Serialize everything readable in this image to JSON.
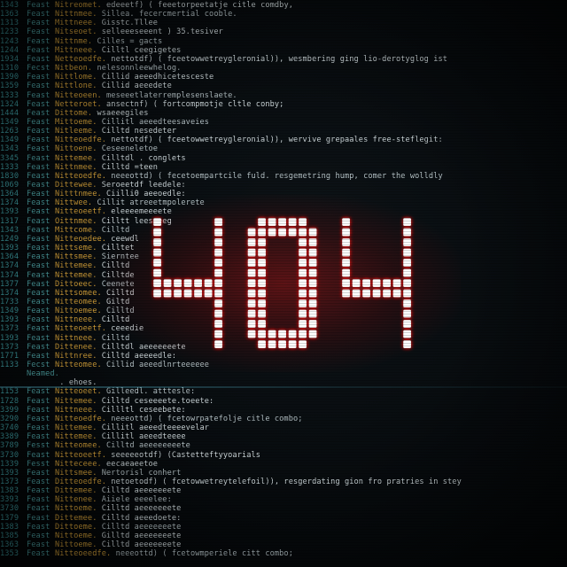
{
  "error": {
    "code": "404",
    "glow_color": "#c81818",
    "dot_color": "#ffffff"
  },
  "colors": {
    "line_number": "#3f9fa4",
    "keyword": "#4fa6a8",
    "class_name": "#d9a43a",
    "code_text": "#cfd9dc",
    "background": "#050a0d"
  },
  "code_lines": [
    {
      "num": "1343",
      "kw": "Feast",
      "cls": "Nitreomet.",
      "rest": "edeeetf) ( feeetorpeetatje citle comdby,"
    },
    {
      "num": "1363",
      "kw": "Feast",
      "cls": "Nittnmee.",
      "rest": "Sillea.  fecercmertial cooble."
    },
    {
      "num": "1313",
      "kw": "Feast",
      "cls": "Mittneee.",
      "rest": "Gisstc.Tllee"
    },
    {
      "num": "1233",
      "kw": "Feast",
      "cls": "Nitseoet.",
      "rest": "selleeeseeent ) 35.tesiver"
    },
    {
      "num": "1243",
      "kw": "Feast",
      "cls": "Nittnme.",
      "rest": "Cilles  =  gacts"
    },
    {
      "num": "1244",
      "kw": "Feast",
      "cls": "Mittneee.",
      "rest": "Cilltl ceegigetes"
    },
    {
      "num": "1934",
      "kw": "Feast",
      "cls": "Netteoedfe.",
      "rest": "nettotdf) ( fceetowwetreygleronial)), wesmbering ging lio-derotyglog ist"
    },
    {
      "num": "1310",
      "kw": "Fecst",
      "cls": "Nitbeon.",
      "rest": "nelesonnleewhelog."
    },
    {
      "num": "1390",
      "kw": "Feast",
      "cls": "Nittlome.",
      "rest": "Cillid  aeeedhicetesceste"
    },
    {
      "num": "1359",
      "kw": "Feast",
      "cls": "Nittlone.",
      "rest": "Cillid  aeeedete"
    },
    {
      "num": "1333",
      "kw": "Feast",
      "cls": "Nitteoeen.",
      "rest": "meseeetlaterremplesenslaete."
    },
    {
      "num": "1324",
      "kw": "Feast",
      "cls": "Netteroet.",
      "rest": "ansectnf) ( fortcompmotje cltle conby;"
    },
    {
      "num": "1444",
      "kw": "Feast",
      "cls": "Dittome.",
      "rest": "wsaeeegiles"
    },
    {
      "num": "1349",
      "kw": "Feast",
      "cls": "Mittoeme.",
      "rest": "Cillitl aeeedteesaveies"
    },
    {
      "num": "1263",
      "kw": "Feast",
      "cls": "Nitleeme.",
      "rest": "Cilltd  nesedeter"
    },
    {
      "num": "1349",
      "kw": "Feast",
      "cls": "Nitteoedfe.",
      "rest": "nettotdf) ( fceetowwetreygleronial)), wervive grepaales free-steflegit:"
    },
    {
      "num": "1343",
      "kw": "Feast",
      "cls": "Nittoene.",
      "rest": "Ceseeneletoe"
    },
    {
      "num": "3345",
      "kw": "Feast",
      "cls": "Nittemee.",
      "rest": "Cilltdl . conglets"
    },
    {
      "num": "1333",
      "kw": "Feast",
      "cls": "Nittnmee.",
      "rest": "Cilltd  =teen"
    },
    {
      "num": "1830",
      "kw": "Feast",
      "cls": "Nitteoedfe.",
      "rest": "neeeottd) ( fecetoempartcile fuld. resgemetring hump, comer the wolldly"
    },
    {
      "num": "1069",
      "kw": "Feast",
      "cls": "Dittewee.",
      "rest": "Seroeetdf  leedele:"
    },
    {
      "num": "1364",
      "kw": "Feast",
      "cls": "Nitttnmee.",
      "rest": "Ciilli0  aeeoedle:"
    },
    {
      "num": "1374",
      "kw": "Feast",
      "cls": "Nittwee.",
      "rest": "Cillit  atreeetmpolerete"
    },
    {
      "num": "1393",
      "kw": "Feast",
      "cls": "Nitteoeetf.",
      "rest": "eleeeemeeeete"
    },
    {
      "num": "1317",
      "kw": "Feast",
      "cls": "Oittnmee.",
      "rest": "Cilltt  leeseeeg"
    },
    {
      "num": "1343",
      "kw": "Feast",
      "cls": "Mittcome.",
      "rest": "Cilltd"
    },
    {
      "num": "1249",
      "kw": "Feast",
      "cls": "Nitteoedee.",
      "rest": "ceewdl"
    },
    {
      "num": "1393",
      "kw": "Feast",
      "cls": "Nittseme.",
      "rest": "Cilltet"
    },
    {
      "num": "1364",
      "kw": "Feast",
      "cls": "Nittsmee.",
      "rest": "Sierntee"
    },
    {
      "num": "1374",
      "kw": "Feast",
      "cls": "Nittemee.",
      "rest": "Cilltd"
    },
    {
      "num": "1374",
      "kw": "Feast",
      "cls": "Nittemee.",
      "rest": "Cilltde"
    },
    {
      "num": "1377",
      "kw": "Feast",
      "cls": "Dittoeec.",
      "rest": "Ceenete"
    },
    {
      "num": "1374",
      "kw": "Feast",
      "cls": "Nittsomee.",
      "rest": "Cilltd"
    },
    {
      "num": "1733",
      "kw": "Feast",
      "cls": "Nitteomee.",
      "rest": "Giltd"
    },
    {
      "num": "1349",
      "kw": "Feast",
      "cls": "Nittoemee.",
      "rest": "Cilltd"
    },
    {
      "num": "1393",
      "kw": "Feast",
      "cls": "Nittneee.",
      "rest": "Cilltd"
    },
    {
      "num": "1373",
      "kw": "Feast",
      "cls": "Nitteoeetf.",
      "rest": "ceeedie"
    },
    {
      "num": "1393",
      "kw": "Feast",
      "cls": "Nittneee.",
      "rest": "Cilltd"
    },
    {
      "num": "1373",
      "kw": "Feast",
      "cls": "Dittenee.",
      "rest": "Cilltdl  aeeeeeeete"
    },
    {
      "num": "1771",
      "kw": "Feast",
      "cls": "Nittnree.",
      "rest": "Cilltd  aeeeedle:"
    },
    {
      "num": "1133",
      "kw": "Fecst",
      "cls": "Nitteomee.",
      "rest": "Cillid  aeeedlnrteeeeee"
    },
    {
      "num": "",
      "kw": "Neamed.",
      "cls": "",
      "rest": ""
    },
    {
      "num": "",
      "kw": "",
      "cls": "",
      "rest": "                   . ehoes."
    },
    {
      "num": "1153",
      "kw": "Feast",
      "cls": "Nitteoeet.",
      "rest": "Gilleedl.  atttesle:"
    },
    {
      "num": "1728",
      "kw": "Feast",
      "cls": "Nittemee.",
      "rest": "Cilltd  ceseeeete.toeete:"
    },
    {
      "num": "3399",
      "kw": "Feast",
      "cls": "Nittneee.",
      "rest": "Cillltl  ceseebete:"
    },
    {
      "num": "3290",
      "kw": "Feast",
      "cls": "Nitteoedfe.",
      "rest": "neeeottd) ( fcetowrpatefolje citle combo;"
    },
    {
      "num": "3740",
      "kw": "Feast",
      "cls": "Nittemee.",
      "rest": "Cillitl  aeeedteeeevelar"
    },
    {
      "num": "3389",
      "kw": "Feast",
      "cls": "Nittemee.",
      "rest": "Cillitl  aeeedteeee"
    },
    {
      "num": "3789",
      "kw": "Fesst",
      "cls": "Nitteomee.",
      "rest": "Cilltd  aeeeeeeeete"
    },
    {
      "num": "3730",
      "kw": "Feast",
      "cls": "Nitteoeetf.",
      "rest": "seeeeeotdf) (Castetteftyyoarials"
    },
    {
      "num": "1339",
      "kw": "Fesst",
      "cls": "Nitteceee.",
      "rest": "eecaeaeetoe"
    },
    {
      "num": "1393",
      "kw": "Feast",
      "cls": "Nittsmee.",
      "rest": "Nertorisl conhert"
    },
    {
      "num": "1373",
      "kw": "Feast",
      "cls": "Ditteoedfe.",
      "rest": "netoetodf) ( fcetowwetreytelefoil)), resgerdating gion fro pratries in stey"
    },
    {
      "num": "1383",
      "kw": "Feast",
      "cls": "Dittemee.",
      "rest": "Cilltd  aeeeeeeete"
    },
    {
      "num": "3393",
      "kw": "Feast",
      "cls": "Nittenee.",
      "rest": "Aiiele  eeeelee:"
    },
    {
      "num": "3730",
      "kw": "Feast",
      "cls": "Nittoeme.",
      "rest": "Cilltd  aeeeeeeete"
    },
    {
      "num": "1379",
      "kw": "Feast",
      "cls": "Dittemee.",
      "rest": "Cilltd  aeeedoete:"
    },
    {
      "num": "1383",
      "kw": "Feast",
      "cls": "Dittoeme.",
      "rest": "Cilltd  aeeeeeeete"
    },
    {
      "num": "1385",
      "kw": "Feast",
      "cls": "Nittoeme.",
      "rest": "Gilltd  aeeeeeeete"
    },
    {
      "num": "1363",
      "kw": "Feast",
      "cls": "Nittoeme.",
      "rest": "Cilltd  aeeeeeeete"
    },
    {
      "num": "1353",
      "kw": "Feast",
      "cls": "Nitteoeedfe.",
      "rest": "neeeottd) ( fcetowmperiele citt combo;"
    }
  ]
}
